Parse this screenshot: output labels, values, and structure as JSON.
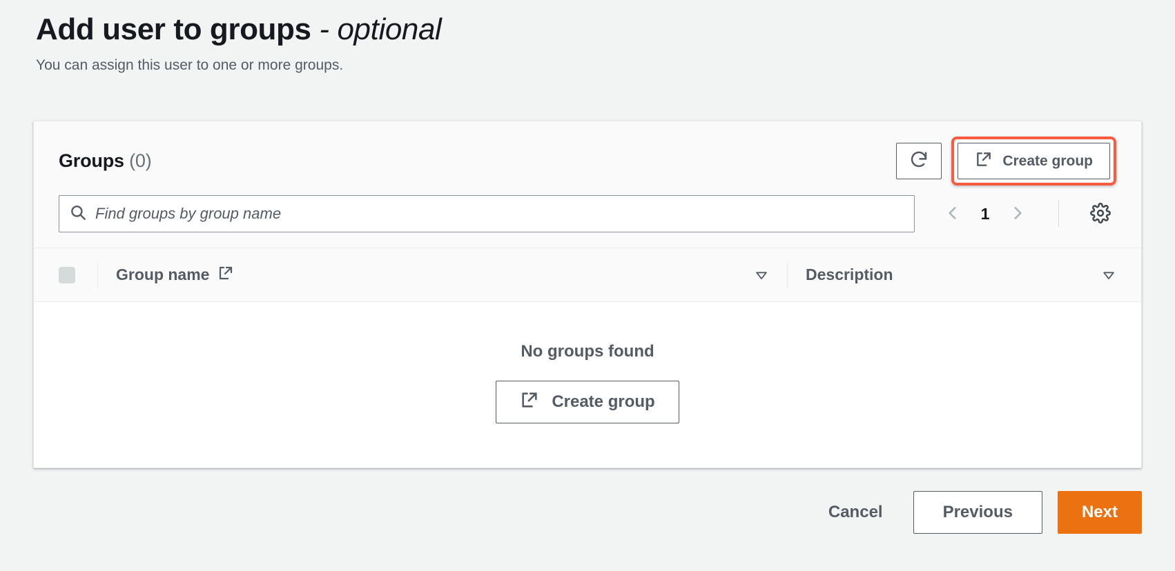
{
  "header": {
    "title_main": "Add user to groups",
    "title_dash": " - ",
    "title_optional": "optional",
    "subtitle": "You can assign this user to one or more groups."
  },
  "card": {
    "title": "Groups",
    "count": "(0)",
    "refresh_icon": "refresh-icon",
    "create_group_label": "Create group",
    "create_group_icon": "external-link-icon",
    "highlight_color": "#f95b41"
  },
  "search": {
    "icon": "search-icon",
    "placeholder": "Find groups by group name",
    "value": ""
  },
  "pagination": {
    "prev_icon": "chevron-left-icon",
    "page": "1",
    "next_icon": "chevron-right-icon",
    "settings_icon": "gear-icon"
  },
  "table": {
    "select_all": "select-all-checkbox",
    "columns": [
      {
        "label": "Group name",
        "icon": "external-link-icon",
        "sort_icon": "sort-descending-icon"
      },
      {
        "label": "Description",
        "icon": "",
        "sort_icon": "sort-descending-icon"
      }
    ],
    "rows": []
  },
  "empty_state": {
    "message": "No groups found",
    "button_label": "Create group",
    "button_icon": "external-link-icon"
  },
  "footer": {
    "cancel_label": "Cancel",
    "previous_label": "Previous",
    "next_label": "Next",
    "next_color": "#ec7211"
  }
}
